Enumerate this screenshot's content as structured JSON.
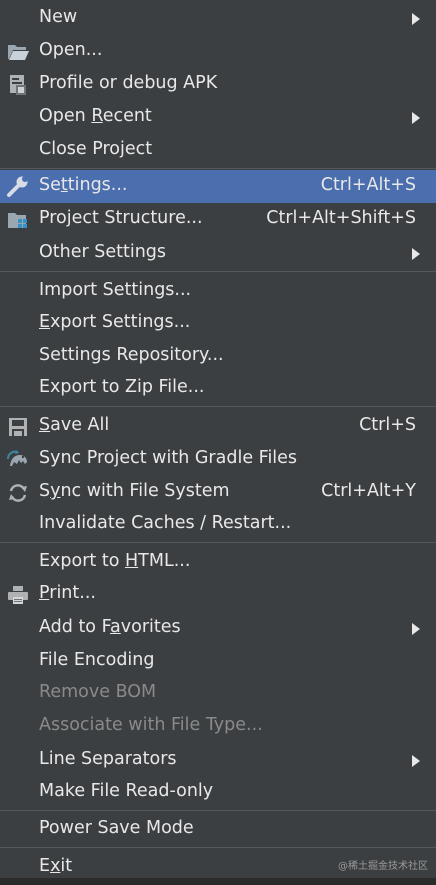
{
  "menu": {
    "new": {
      "label": "New"
    },
    "open": {
      "label": "Open..."
    },
    "profile_debug_apk": {
      "label": "Profile or debug APK"
    },
    "open_recent": {
      "pre": "Open ",
      "mn": "R",
      "post": "ecent"
    },
    "close_project": {
      "label": "Close Project"
    },
    "settings": {
      "pre": "Se",
      "mn": "t",
      "post": "tings...",
      "shortcut": "Ctrl+Alt+S"
    },
    "project_structure": {
      "label": "Project Structure...",
      "shortcut": "Ctrl+Alt+Shift+S"
    },
    "other_settings": {
      "label": "Other Settings"
    },
    "import_settings": {
      "label": "Import Settings..."
    },
    "export_settings": {
      "mn": "E",
      "post": "xport Settings..."
    },
    "settings_repository": {
      "label": "Settings Repository..."
    },
    "export_zip": {
      "label": "Export to Zip File..."
    },
    "save_all": {
      "mn": "S",
      "post": "ave All",
      "shortcut": "Ctrl+S"
    },
    "sync_gradle": {
      "label": "Sync Project with Gradle Files"
    },
    "sync_fs": {
      "pre": "S",
      "mn": "y",
      "post": "nc with File System",
      "shortcut": "Ctrl+Alt+Y"
    },
    "invalidate_caches": {
      "label": "Invalidate Caches / Restart..."
    },
    "export_html": {
      "pre": "Export to ",
      "mn": "H",
      "post": "TML..."
    },
    "print": {
      "mn": "P",
      "post": "rint..."
    },
    "add_favorites": {
      "pre": "Add to F",
      "mn": "a",
      "post": "vorites"
    },
    "file_encoding": {
      "label": "File Encoding"
    },
    "remove_bom": {
      "label": "Remove BOM"
    },
    "associate_file_type": {
      "label": "Associate with File Type..."
    },
    "line_separators": {
      "label": "Line Separators"
    },
    "make_read_only": {
      "label": "Make File Read-only"
    },
    "power_save": {
      "label": "Power Save Mode"
    },
    "exit": {
      "pre": "E",
      "mn": "x",
      "post": "it"
    }
  },
  "watermark": "@稀土掘金技术社区",
  "colors": {
    "background": "#3c3f41",
    "selection": "#4b6eaf",
    "text": "#e8e8e8",
    "disabled_text": "#8a8a8a",
    "separator": "#55585a"
  }
}
